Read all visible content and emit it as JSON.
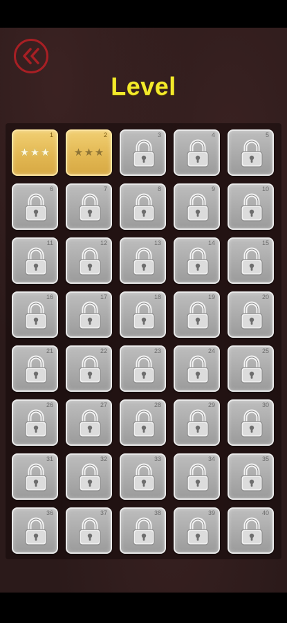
{
  "header": {
    "title": "Level",
    "back_icon": "rewind-double-chevron-left-icon",
    "accent": "#a81f24",
    "title_color": "#f3ea2a"
  },
  "levels": [
    {
      "number": "1",
      "state": "unlocked",
      "stars": 3,
      "max_stars": 3
    },
    {
      "number": "2",
      "state": "unlocked",
      "stars": 0,
      "max_stars": 3
    },
    {
      "number": "3",
      "state": "locked"
    },
    {
      "number": "4",
      "state": "locked"
    },
    {
      "number": "5",
      "state": "locked"
    },
    {
      "number": "6",
      "state": "locked"
    },
    {
      "number": "7",
      "state": "locked"
    },
    {
      "number": "8",
      "state": "locked"
    },
    {
      "number": "9",
      "state": "locked"
    },
    {
      "number": "10",
      "state": "locked"
    },
    {
      "number": "11",
      "state": "locked"
    },
    {
      "number": "12",
      "state": "locked"
    },
    {
      "number": "13",
      "state": "locked"
    },
    {
      "number": "14",
      "state": "locked"
    },
    {
      "number": "15",
      "state": "locked"
    },
    {
      "number": "16",
      "state": "locked"
    },
    {
      "number": "17",
      "state": "locked"
    },
    {
      "number": "18",
      "state": "locked"
    },
    {
      "number": "19",
      "state": "locked"
    },
    {
      "number": "20",
      "state": "locked"
    },
    {
      "number": "21",
      "state": "locked"
    },
    {
      "number": "22",
      "state": "locked"
    },
    {
      "number": "23",
      "state": "locked"
    },
    {
      "number": "24",
      "state": "locked"
    },
    {
      "number": "25",
      "state": "locked"
    },
    {
      "number": "26",
      "state": "locked"
    },
    {
      "number": "27",
      "state": "locked"
    },
    {
      "number": "28",
      "state": "locked"
    },
    {
      "number": "29",
      "state": "locked"
    },
    {
      "number": "30",
      "state": "locked"
    },
    {
      "number": "31",
      "state": "locked"
    },
    {
      "number": "32",
      "state": "locked"
    },
    {
      "number": "33",
      "state": "locked"
    },
    {
      "number": "34",
      "state": "locked"
    },
    {
      "number": "35",
      "state": "locked"
    },
    {
      "number": "36",
      "state": "locked"
    },
    {
      "number": "37",
      "state": "locked"
    },
    {
      "number": "38",
      "state": "locked"
    },
    {
      "number": "39",
      "state": "locked"
    },
    {
      "number": "40",
      "state": "locked"
    }
  ],
  "icons": {
    "locked": "padlock-icon",
    "star": "star-icon"
  }
}
